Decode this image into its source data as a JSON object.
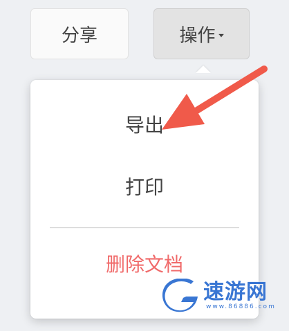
{
  "toolbar": {
    "share_label": "分享",
    "ops_label": "操作"
  },
  "menu": {
    "items": [
      {
        "label": "导出"
      },
      {
        "label": "打印"
      },
      {
        "label": "删除文档"
      }
    ]
  },
  "watermark": {
    "title": "速游网",
    "url": "www.86886.com"
  },
  "colors": {
    "danger": "#f06a6a",
    "arrow": "#f05a4a",
    "watermark": "#2f6fd1"
  },
  "icons": {
    "caret": "caret-down-icon",
    "arrow": "arrow-annotation-icon",
    "logo": "watermark-logo-icon"
  }
}
